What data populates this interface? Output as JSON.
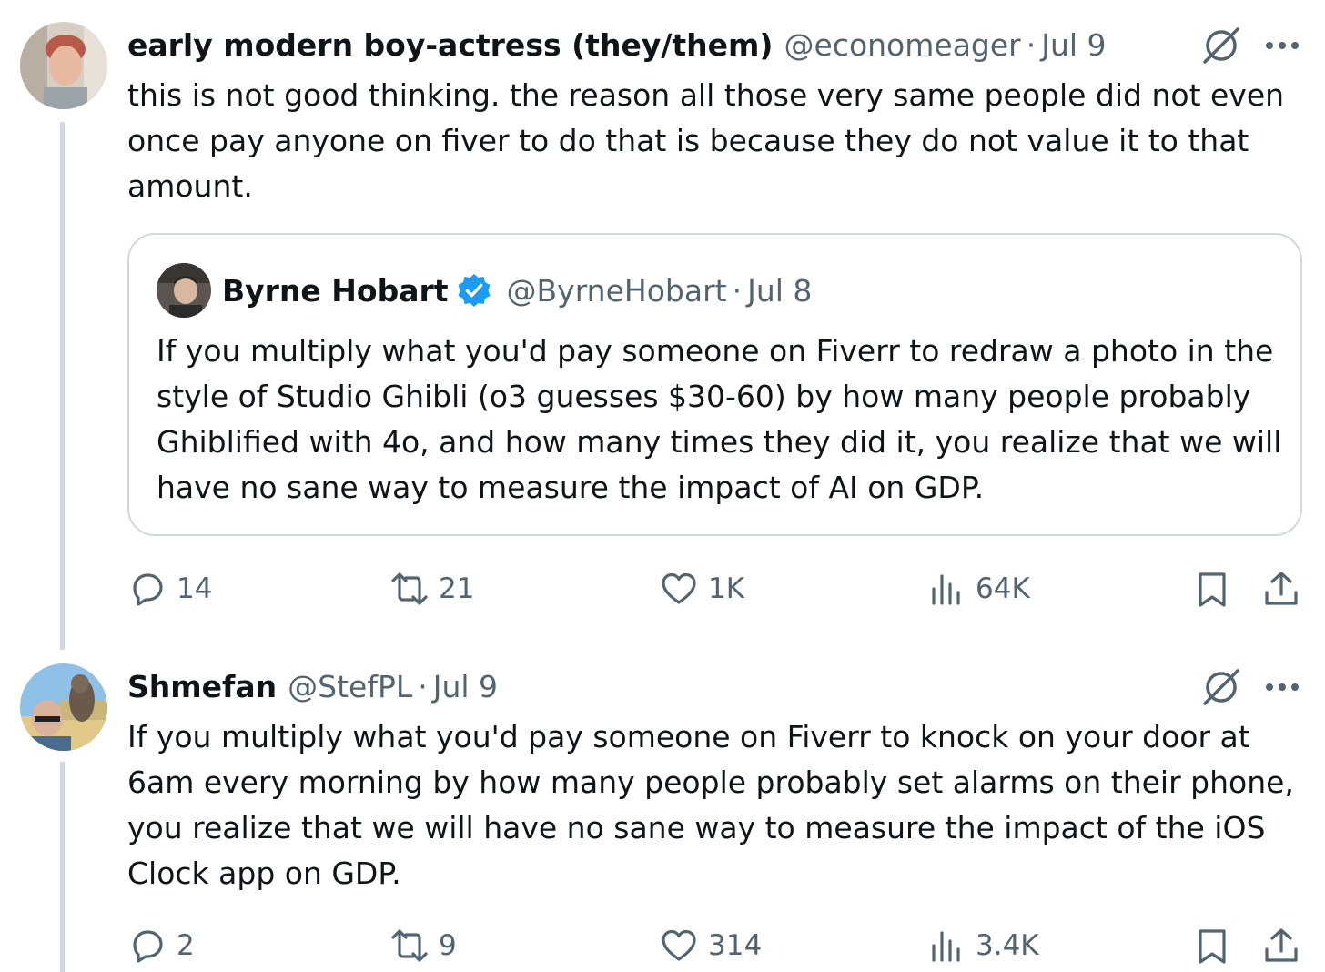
{
  "tweets": [
    {
      "display_name": "early modern boy-actress (they/them)",
      "handle": "@economeager",
      "separator": "·",
      "date": "Jul 9",
      "text": "this is not good thinking. the reason all those very same people did not even once pay anyone on fiver to do that is because they do not value it to that amount.",
      "quote": {
        "display_name": "Byrne Hobart",
        "handle": "@ByrneHobart",
        "separator": "·",
        "date": "Jul 8",
        "text": "If you multiply what you'd pay someone on Fiverr to redraw a photo in the style of Studio Ghibli (o3 guesses $30-60) by how many people probably Ghiblified with 4o, and how many times they did it, you realize that we will have no sane way to measure the impact of AI on GDP."
      },
      "stats": {
        "replies": "14",
        "reposts": "21",
        "likes": "1K",
        "views": "64K"
      }
    },
    {
      "display_name": "Shmefan",
      "handle": "@StefPL",
      "separator": "·",
      "date": "Jul 9",
      "text": "If you multiply what you'd pay someone on Fiverr to knock on your door at 6am every morning by how many people probably set alarms on their phone, you realize that we will have no sane way to measure the impact of the iOS Clock app on GDP.",
      "stats": {
        "replies": "2",
        "reposts": "9",
        "likes": "314",
        "views": "3.4K"
      }
    }
  ],
  "colors": {
    "text_primary": "#0f1419",
    "text_secondary": "#536471",
    "border": "#cfd9de",
    "verified": "#1d9bf0"
  },
  "icons": [
    "grok-icon",
    "more-icon",
    "verified-icon",
    "reply-icon",
    "repost-icon",
    "like-icon",
    "views-icon",
    "bookmark-icon",
    "share-icon"
  ]
}
